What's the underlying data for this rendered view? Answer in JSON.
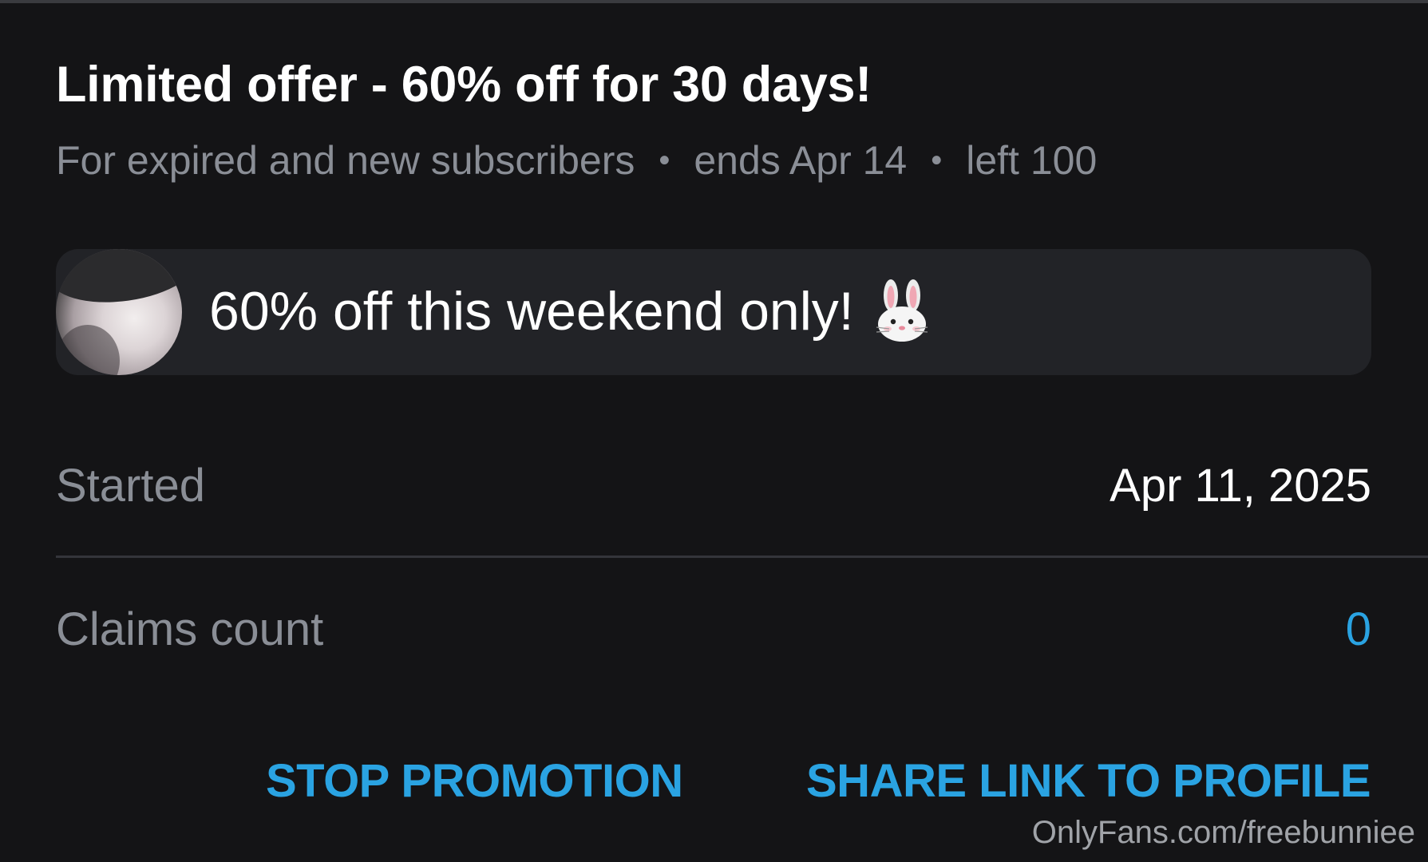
{
  "offer": {
    "title": "Limited offer - 60% off for 30 days!",
    "audience": "For expired and new subscribers",
    "separator": "•",
    "ends": "ends Apr 14",
    "left": "left 100"
  },
  "message": {
    "text": "60% off this weekend only!",
    "emoji_icon": "rabbit-face-icon"
  },
  "details": {
    "started_label": "Started",
    "started_value": "Apr 11, 2025",
    "claims_label": "Claims count",
    "claims_value": "0"
  },
  "actions": {
    "stop_label": "STOP PROMOTION",
    "share_label": "SHARE LINK TO PROFILE"
  },
  "watermark": "OnlyFans.com/freebunniee",
  "colors": {
    "background": "#141416",
    "card": "#222327",
    "accent": "#2aa3e2",
    "muted_text": "#8a8e96",
    "primary_text": "#ffffff"
  }
}
